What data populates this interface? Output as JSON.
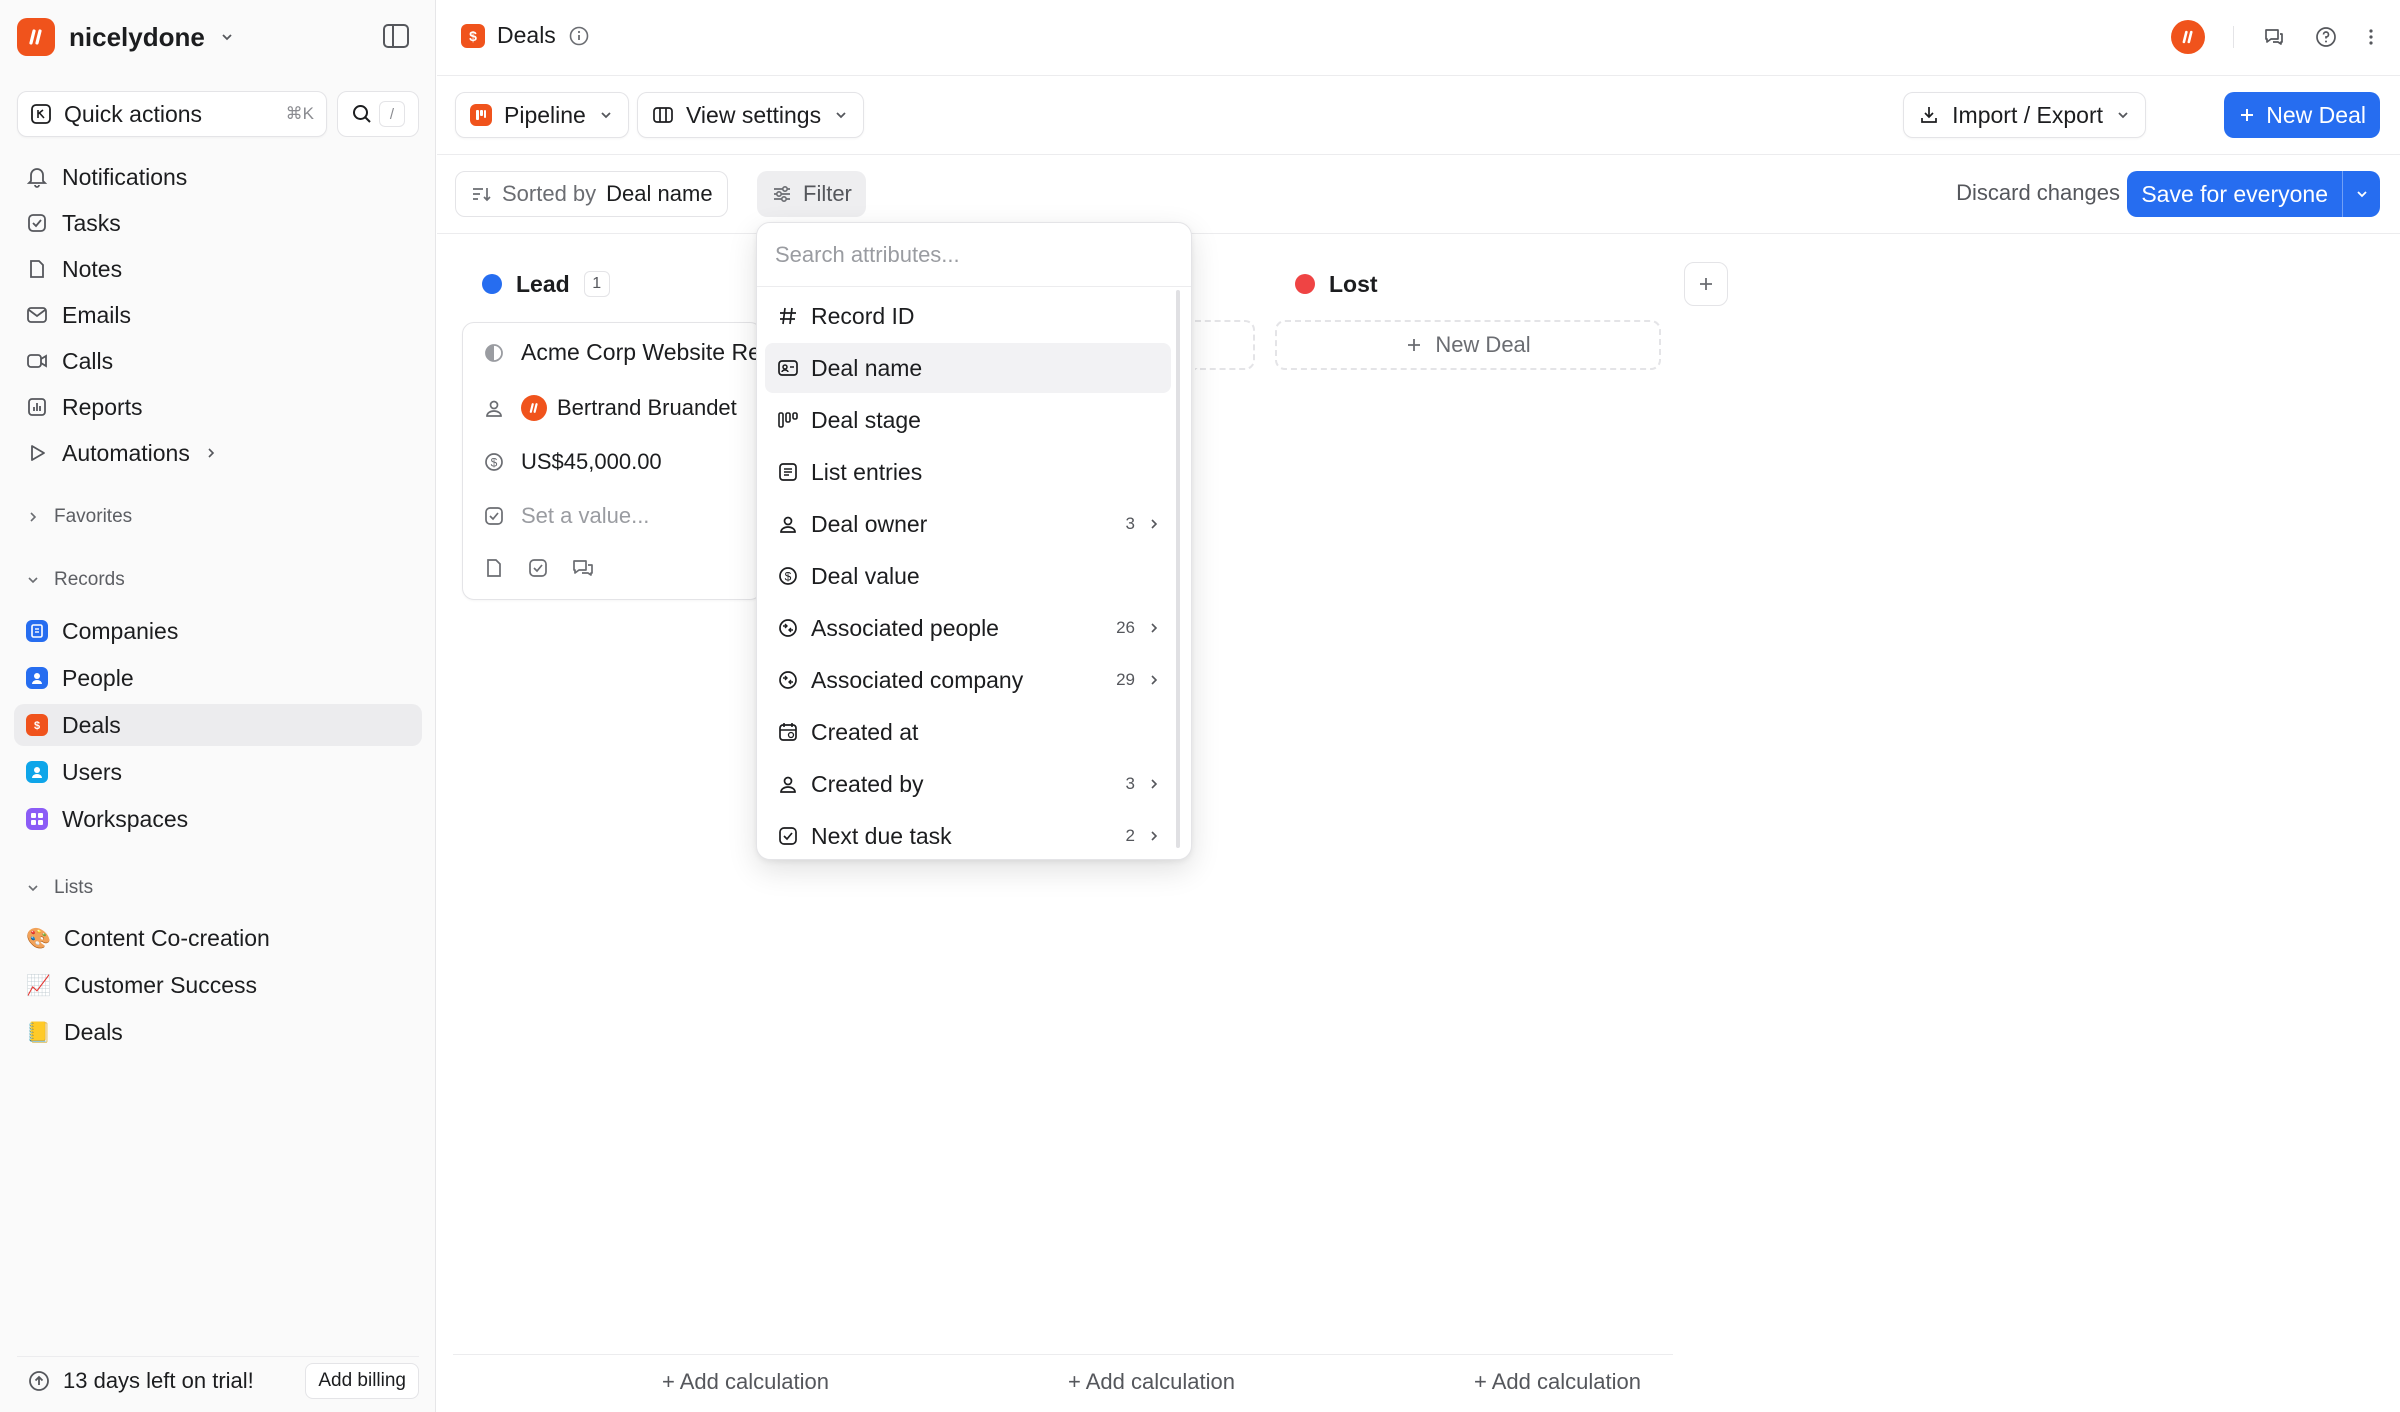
{
  "workspace": {
    "name": "nicelydone"
  },
  "sidebar": {
    "quick_actions": "Quick actions",
    "quick_shortcut": "⌘K",
    "search_shortcut": "/",
    "nav": [
      "Notifications",
      "Tasks",
      "Notes",
      "Emails",
      "Calls",
      "Reports",
      "Automations"
    ],
    "favorites_label": "Favorites",
    "records_label": "Records",
    "records": [
      "Companies",
      "People",
      "Deals",
      "Users",
      "Workspaces"
    ],
    "lists_label": "Lists",
    "lists": [
      "Content Co-creation",
      "Customer Success",
      "Deals"
    ],
    "trial_text": "13 days left on trial!",
    "billing_button": "Add billing"
  },
  "topbar": {
    "title": "Deals"
  },
  "toolbar": {
    "view_name": "Pipeline",
    "view_settings": "View settings",
    "import_export": "Import / Export",
    "new_deal": "New Deal"
  },
  "filterbar": {
    "sorted_by": "Sorted by",
    "sort_field": "Deal name",
    "filter": "Filter",
    "discard": "Discard changes",
    "save": "Save for everyone"
  },
  "board": {
    "columns": [
      {
        "name": "Lead",
        "count": "1",
        "color": "#266df0"
      },
      {
        "name": "Lost",
        "count": "",
        "color": "#ef4444"
      }
    ],
    "card": {
      "title": "Acme Corp Website Re",
      "owner": "Bertrand Bruandet",
      "value": "US$45,000.00",
      "task_placeholder": "Set a value..."
    },
    "new_deal": "New Deal",
    "add_calculation": "+ Add calculation"
  },
  "dropdown": {
    "search_placeholder": "Search attributes...",
    "items": [
      {
        "label": "Record ID",
        "icon": "hash-icon",
        "count": ""
      },
      {
        "label": "Deal name",
        "icon": "id-card-icon",
        "count": ""
      },
      {
        "label": "Deal stage",
        "icon": "stage-icon",
        "count": ""
      },
      {
        "label": "List entries",
        "icon": "list-icon",
        "count": ""
      },
      {
        "label": "Deal owner",
        "icon": "user-icon",
        "count": "3"
      },
      {
        "label": "Deal value",
        "icon": "currency-icon",
        "count": ""
      },
      {
        "label": "Associated people",
        "icon": "relation-icon",
        "count": "26"
      },
      {
        "label": "Associated company",
        "icon": "relation-icon",
        "count": "29"
      },
      {
        "label": "Created at",
        "icon": "calendar-icon",
        "count": ""
      },
      {
        "label": "Created by",
        "icon": "user-icon",
        "count": "3"
      },
      {
        "label": "Next due task",
        "icon": "checkbox-icon",
        "count": "2"
      }
    ]
  },
  "colors": {
    "brand": "#f0531c",
    "primary": "#266df0"
  }
}
